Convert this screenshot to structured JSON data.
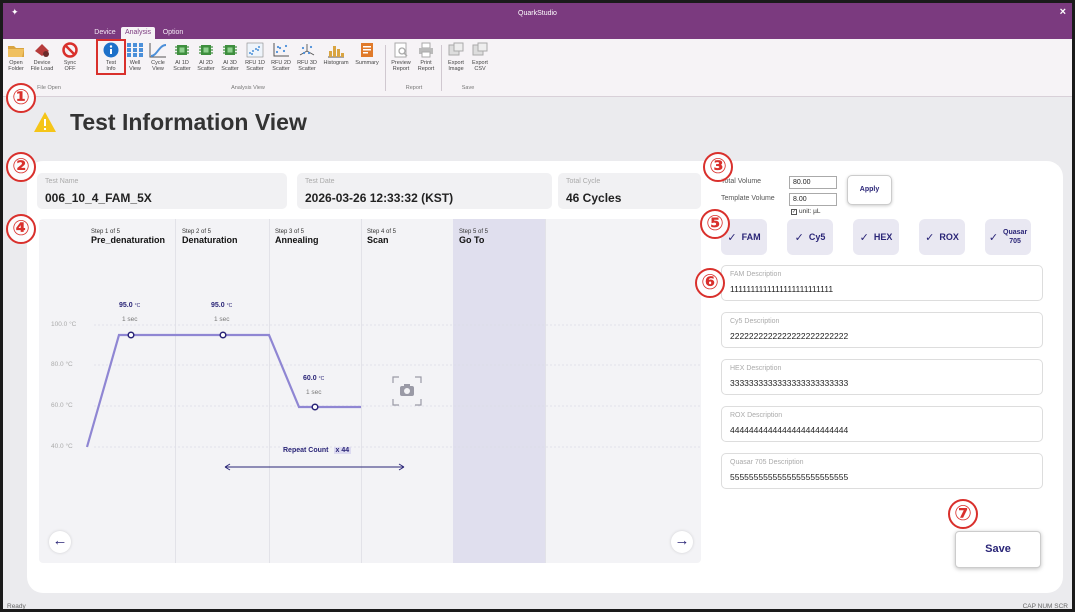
{
  "window": {
    "title": "QuarkStudio",
    "close_glyph": "×"
  },
  "tabs": [
    {
      "label": "Device",
      "active": false
    },
    {
      "label": "Analysis",
      "active": true
    },
    {
      "label": "Option",
      "active": false
    }
  ],
  "ribbon": {
    "buttons": [
      {
        "line1": "Open",
        "line2": "Folder",
        "icon": "open-folder-icon",
        "color": "#d9a441"
      },
      {
        "line1": "Device",
        "line2": "File Load",
        "icon": "device-file-load-icon",
        "color": "#b63b3b"
      },
      {
        "line1": "Sync",
        "line2": "OFF",
        "icon": "sync-off-icon",
        "color": "#d9302c"
      },
      {
        "line1": "Test",
        "line2": "Info",
        "icon": "info-icon",
        "color": "#1d70c9"
      },
      {
        "line1": "Well",
        "line2": "View",
        "icon": "well-view-icon",
        "color": "#4b8fd9"
      },
      {
        "line1": "Cycle",
        "line2": "View",
        "icon": "cycle-view-icon",
        "color": "#4b8fd9"
      },
      {
        "line1": "AI 1D",
        "line2": "Scatter",
        "icon": "chip-icon",
        "color": "#3f8f3f"
      },
      {
        "line1": "AI 2D",
        "line2": "Scatter",
        "icon": "chip-icon",
        "color": "#3f8f3f"
      },
      {
        "line1": "AI 3D",
        "line2": "Scatter",
        "icon": "chip-icon",
        "color": "#3f8f3f"
      },
      {
        "line1": "RFU 1D",
        "line2": "Scatter",
        "icon": "scatter-icon",
        "color": "#4b8fd9"
      },
      {
        "line1": "RFU 2D",
        "line2": "Scatter",
        "icon": "scatter-icon",
        "color": "#4b8fd9"
      },
      {
        "line1": "RFU 3D",
        "line2": "Scatter",
        "icon": "scatter-3d-icon",
        "color": "#4b8fd9"
      },
      {
        "line1": "Histogram",
        "line2": "",
        "icon": "histogram-icon",
        "color": "#d9a441"
      },
      {
        "line1": "Summary",
        "line2": "",
        "icon": "summary-icon",
        "color": "#e07a2a"
      },
      {
        "line1": "Preview",
        "line2": "Report",
        "icon": "preview-report-icon",
        "color": "#aaaaaa"
      },
      {
        "line1": "Print",
        "line2": "Report",
        "icon": "print-icon",
        "color": "#aaaaaa"
      },
      {
        "line1": "Export",
        "line2": "Image",
        "icon": "export-image-icon",
        "color": "#aaaaaa"
      },
      {
        "line1": "Export",
        "line2": "CSV",
        "icon": "export-csv-icon",
        "color": "#aaaaaa"
      }
    ],
    "groups": {
      "file_open": "File Open",
      "analysis_view": "Analysis View",
      "report": "Report",
      "save": "Save"
    }
  },
  "badges": [
    "①",
    "②",
    "③",
    "④",
    "⑤",
    "⑥",
    "⑦"
  ],
  "page": {
    "title": "Test Information View"
  },
  "info": {
    "test_name_label": "Test Name",
    "test_name": "006_10_4_FAM_5X",
    "test_date_label": "Test Date",
    "test_date": "2026-03-26 12:33:32 (KST)",
    "total_cycle_label": "Total Cycle",
    "total_cycle": "46 Cycles"
  },
  "protocol": {
    "steps": [
      {
        "count": "Step 1 of 5",
        "name": "Pre_denaturation"
      },
      {
        "count": "Step 2 of 5",
        "name": "Denaturation"
      },
      {
        "count": "Step 3 of 5",
        "name": "Annealing"
      },
      {
        "count": "Step 4 of 5",
        "name": "Scan"
      },
      {
        "count": "Step 5 of 5",
        "name": "Go To"
      }
    ],
    "y_labels": [
      "100.0 °C",
      "80.0 °C",
      "60.0 °C",
      "40.0 °C"
    ],
    "points": [
      {
        "temp": "95.0",
        "unit": "°C",
        "time": "1 sec"
      },
      {
        "temp": "95.0",
        "unit": "°C",
        "time": "1 sec"
      },
      {
        "temp": "60.0",
        "unit": "°C",
        "time": "1 sec"
      }
    ],
    "repeat_label": "Repeat Count",
    "repeat_value": "x 44",
    "prev_glyph": "←",
    "next_glyph": "→"
  },
  "volume": {
    "total_label": "Total Volume",
    "total_value": "80.00",
    "template_label": "Template Volume",
    "template_value": "8.00",
    "unit_label": "unit: µL",
    "apply_label": "Apply"
  },
  "dyes": [
    {
      "label": "FAM",
      "checked": true
    },
    {
      "label": "Cy5",
      "checked": true
    },
    {
      "label": "HEX",
      "checked": true
    },
    {
      "label": "ROX",
      "checked": true
    },
    {
      "label": "Quasar 705",
      "line1": "Quasar",
      "line2": "705",
      "checked": true
    }
  ],
  "descriptions": [
    {
      "label": "FAM Description",
      "value": "1111111111111111111111111"
    },
    {
      "label": "Cy5 Description",
      "value": "2222222222222222222222222"
    },
    {
      "label": "HEX Description",
      "value": "3333333333333333333333333"
    },
    {
      "label": "ROX Description",
      "value": "4444444444444444444444444"
    },
    {
      "label": "Quasar 705 Description",
      "value": "5555555555555555555555555"
    }
  ],
  "save_label": "Save",
  "status": {
    "left": "Ready",
    "right": "CAP NUM SCR"
  },
  "colors": {
    "title_bar": "#7b3a7f",
    "accent": "#2a2577",
    "badge": "#d9302c",
    "warning": "#f5c518"
  }
}
